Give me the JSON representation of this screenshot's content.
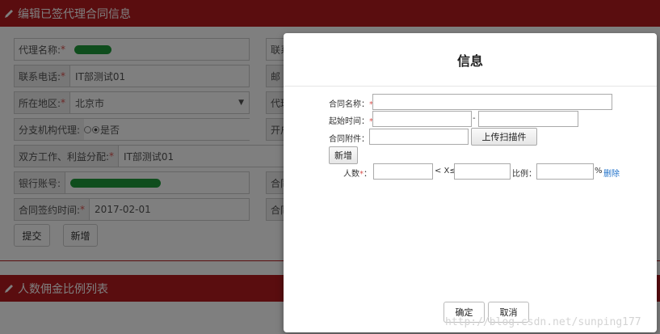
{
  "background": {
    "section1_title": "编辑已签代理合同信息",
    "section2_title": "人数佣金比例列表",
    "fields": {
      "agent_name_label": "代理名称:",
      "phone_label": "联系电话:",
      "phone_value": "IT部测试01",
      "region_label": "所在地区:",
      "region_value": "北京市",
      "branch_label": "分支机构代理:",
      "branch_value": "是否",
      "split_label": "双方工作、利益分配:",
      "split_value": "IT部测试01",
      "bank_label": "银行账号:",
      "sign_time_label": "合同签约时间:",
      "sign_time_value": "2017-02-01",
      "right_col_1": "联系",
      "right_col_2": "邮",
      "right_col_3": "代理",
      "right_col_4": "开户",
      "right_col_5": "合同",
      "right_col_6": "合同"
    },
    "submit_button": "提交",
    "add_button": "新增",
    "required_mark": "*"
  },
  "modal": {
    "title": "信息",
    "contract_name_label": "合同名称：",
    "start_time_label": "起始时间：",
    "dash": "-",
    "attachment_label": "合同附件：",
    "upload_button": "上传扫描件",
    "add_button": "新增",
    "people_label": "人数",
    "colon": "：",
    "range_text": "< X≤",
    "ratio_label": "比例：",
    "percent": "%",
    "delete_link": "删除",
    "confirm_button": "确定",
    "cancel_button": "取消",
    "required_mark": "*"
  },
  "watermark": "http://blog.csdn.net/sunping177",
  "colors": {
    "header_red": "#b51a1e",
    "link_blue": "#1e70c9",
    "required_red": "#d9534f"
  }
}
